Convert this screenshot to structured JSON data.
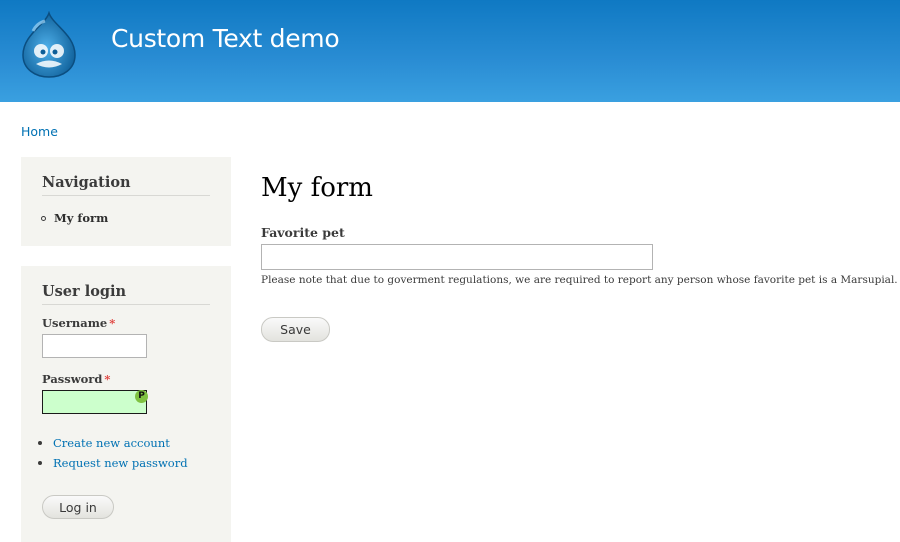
{
  "header": {
    "site_name": "Custom Text demo",
    "logo_icon": "drupal-drop-icon",
    "colors": {
      "gradient_top": "#0f79c3",
      "gradient_bottom": "#3aa0e0"
    }
  },
  "breadcrumb": {
    "home": "Home"
  },
  "sidebar": {
    "navigation": {
      "title": "Navigation",
      "items": [
        {
          "label": "My form"
        }
      ]
    },
    "user_login": {
      "title": "User login",
      "username_label": "Username",
      "password_label": "Password",
      "required_marker": "*",
      "username_value": "",
      "password_value": "",
      "password_badge": "P",
      "links": [
        {
          "label": "Create new account"
        },
        {
          "label": "Request new password"
        }
      ],
      "login_button": "Log in"
    }
  },
  "main": {
    "title": "My form",
    "favorite_pet_label": "Favorite pet",
    "favorite_pet_value": "",
    "favorite_pet_description": "Please note that due to goverment regulations, we are required to report any person whose favorite pet is a Marsupial.",
    "save_button": "Save"
  },
  "colors": {
    "link": "#0071b3",
    "sidebar_bg": "#f4f4f0",
    "required": "#e0403c",
    "password_highlight": "#ccffcc"
  }
}
